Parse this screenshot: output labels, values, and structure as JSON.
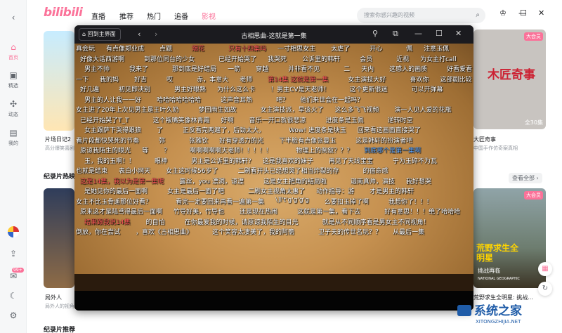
{
  "app": {
    "logo": "bilibili"
  },
  "nav": {
    "back_icon": "chevron-left-icon",
    "tabs": [
      "直播",
      "推荐",
      "热门",
      "追番",
      "影视"
    ],
    "active_tab": "影视",
    "accent": "#fb7299"
  },
  "search": {
    "placeholder": "搜索你感兴趣的视频"
  },
  "window_controls": {
    "skin": "shirt-icon",
    "minimize": "—",
    "maximize": "☐",
    "close": "✕"
  },
  "sidebar": {
    "items": [
      {
        "label": "首页",
        "icon": "home-icon"
      },
      {
        "label": "精选",
        "icon": "bookmark-icon"
      },
      {
        "label": "动态",
        "icon": "pinwheel-icon"
      },
      {
        "label": "我的",
        "icon": "tv-icon"
      }
    ],
    "bottom": {
      "avatar": "avatar-icon",
      "upload": "upload-icon",
      "message_badge": "99+",
      "theme": "moon-icon",
      "settings": "gear-icon"
    }
  },
  "content": {
    "card_left_top": {
      "title": "片场日记2",
      "sub": "高分爆笑喜剧"
    },
    "card_right_top": {
      "title": "木匠奇事",
      "sub": "木匠奇事",
      "poster_text": "木匠奇事",
      "badge": "大会员",
      "episodes": "全30集",
      "subtitle": "大匠奇事",
      "desc": "中国手作仿奇案真相"
    },
    "section": {
      "title": "纪录片热映",
      "see_all": "查看全部 ›"
    },
    "card_left_bottom": {
      "title": "局外人",
      "sub": "局外人的视角"
    },
    "card_right_bottom": {
      "badge": "大会员",
      "poster_title": "荒野求生全明星",
      "poster_sub": "挑战再临",
      "title": "荒野求生全明星: 挑战...",
      "brand": "NATIONAL GEOGRAPHIC"
    },
    "bottom_section": "纪录片推荐"
  },
  "player": {
    "home_button": "回到主界面",
    "title": "古相思曲-这就是第一集",
    "icons": [
      "pin-icon",
      "pip-icon",
      "minimize-icon",
      "maximize-icon",
      "close-icon"
    ]
  },
  "danmaku": [
    "真会玩",
    "有点像郑业成",
    "点题",
    "烟花",
    "只有十四集吗",
    "一寸相思女主",
    "太虐了",
    "开心",
    "佩",
    "注意玉佩",
    "好像大话西游啊",
    "到那位同台的少女",
    "已经开始哭了",
    "我哭死",
    "公诉里的韩轩",
    "会员",
    "近视",
    "为女主打call",
    "男主不帅",
    "我来了",
    "那到底是好结局",
    "一箭",
    "穿越",
    "并非看不见",
    "二",
    "天内",
    "这感人的画质",
    "好看爱看",
    "一下",
    "我的妈",
    "好吉",
    "哎",
    "赤，本意大",
    "老师",
    "第14集 这就是第一集",
    "女主演技大好",
    "喜欢你",
    "这部剧比较",
    "好几遍",
    "初见即决别",
    "男主好眼熟",
    "为什么这么卡",
    "！男主CV是天老师！",
    "这个更新很迷",
    "可以开弹幕",
    "男主的人让我一一好",
    "哈哈哈哈哈哈哈",
    "这声音耳熟",
    "吧？",
    "他们来世会在一起吗？",
    "女主进了20年上次见男主是王叶久奶",
    "梦回雨生如故",
    "女主演技派，早该火了",
    "这么多飞飞视频",
    "演一人见人爱的花瓶",
    "已经开始哭了T_T",
    "这个叛嘴笑像林青霞",
    "好啊",
    "音乐一开口就很悲凉",
    "进度条是玉佩",
    "逆转时空",
    "女主跟萨下哭得跟狼",
    "了",
    "正反看完两遍了，后劲太大，",
    "Wow! 进度条是块玉",
    "回来看这画面直接哭了",
    "看片段都快哭死的节奏",
    "弥",
    "张雅钦",
    "好有穿透力的光",
    "下半脸有点像张曼玉",
    "这是韩轩的扮演者吧",
    "原谅我陌生的眼光",
    "等",
    "？",
    "啊啊啊啊啊天老师！！！！！",
    "物理上的倒叙？？？",
    "到底哪个是第一集啊",
    "玉，我的玉啊！！",
    "眼神",
    "男主是公诉里的韩轩?",
    "这是我喜欢的妹子",
    "再见了天线宝宝",
    "宁为玉碎不为瓦",
    "也就是结束",
    "表白小网天",
    "女主这时候56岁了",
    "二刷看开头已经想哭了相当炸裂的存",
    "的宿命感",
    "这是14集，我以为是第一集呢",
    "露丝，you 漂洞，谅漂",
    "这是女主把角的结局啦",
    "迦南真帅，演技",
    "我好想哭",
    "是她见你的最后一面啊",
    "女主是最后一面了吧",
    "二刷女主视角太惠了",
    "动作指导：游",
    "才是男主的韩轩",
    "女主不比玉骨遥那位好看？",
    "看完一定要回来再看一遍第一集",
    "\\]l't'g'g'g'g",
    "么要扣玉掉了啊",
    "我想你了！！！",
    "原来这才是陆鸢得最后一面啊",
    "竹导好美，竹导也",
    "还是现在热闹",
    "这就是第一集，看下去",
    "好有意思！！！绝了哈哈哈",
    "结果跟我说14集",
    "的自怕",
    "在你最爱我的时候，请原谅我陌生的目光",
    "就是从不同顺序看是男女主不同视角！",
    "倒放，你在尝试",
    "，喜欢《古相思曲》",
    "这个笑容太凄美了，我的阿斋",
    "卫子夫的传世名玩？？",
    "从最后一集"
  ],
  "watermark": {
    "name": "系统之家",
    "url": "XITONGZHIJIA.NET"
  }
}
